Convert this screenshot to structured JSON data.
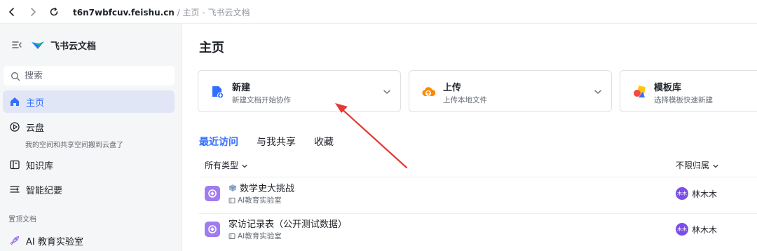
{
  "browser": {
    "url_host": "t6n7wbfcuv.feishu.cn",
    "url_path": " / 主页 - 飞书云文档"
  },
  "sidebar": {
    "app_name": "飞书云文档",
    "search_placeholder": "搜索",
    "items": [
      {
        "label": "主页"
      },
      {
        "label": "云盘",
        "sublabel": "我的空间和共享空间搬到云盘了"
      },
      {
        "label": "知识库"
      },
      {
        "label": "智能纪要"
      }
    ],
    "pinned_section": "置顶文档",
    "pinned_items": [
      {
        "label": "AI 教育实验室"
      }
    ]
  },
  "main": {
    "title": "主页",
    "cards": [
      {
        "title": "新建",
        "subtitle": "新建文档开始协作"
      },
      {
        "title": "上传",
        "subtitle": "上传本地文件"
      },
      {
        "title": "模板库",
        "subtitle": "选择模板快速新建"
      }
    ],
    "tabs": [
      {
        "label": "最近访问"
      },
      {
        "label": "与我共享"
      },
      {
        "label": "收藏"
      }
    ],
    "filter_type": "所有类型",
    "filter_owner": "不限归属",
    "documents": [
      {
        "title": "数学史大挑战",
        "location": "AI教育实验室",
        "owner": "林木木",
        "avatar_text": "木木"
      },
      {
        "title": "家访记录表（公开测试数据）",
        "location": "AI教育实验室",
        "owner": "林木木",
        "avatar_text": "木木"
      }
    ]
  },
  "colors": {
    "accent": "#3370ff",
    "active_bg": "#e1e6f6",
    "annotation_arrow": "#e53935"
  }
}
